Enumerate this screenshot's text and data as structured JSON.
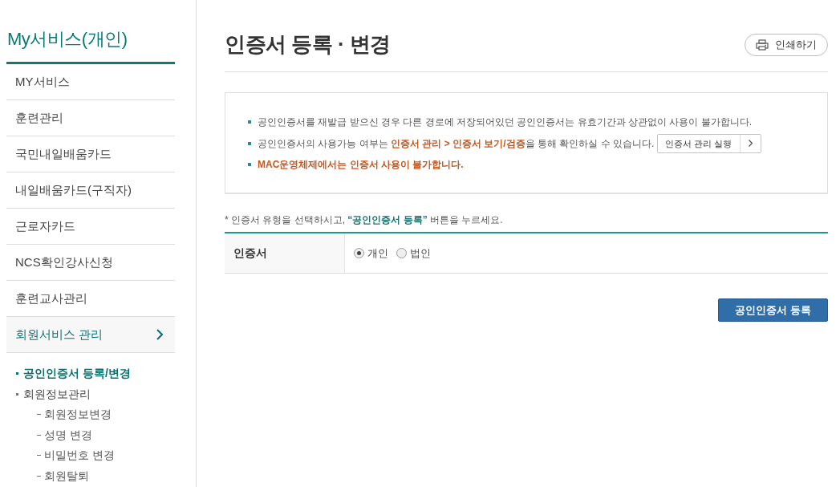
{
  "sidebar": {
    "title": "My서비스(개인)",
    "items": [
      {
        "label": "MY서비스",
        "selected": false
      },
      {
        "label": "훈련관리",
        "selected": false
      },
      {
        "label": "국민내일배움카드",
        "selected": false
      },
      {
        "label": "내일배움카드(구직자)",
        "selected": false
      },
      {
        "label": "근로자카드",
        "selected": false
      },
      {
        "label": "NCS확인강사신청",
        "selected": false
      },
      {
        "label": "훈련교사관리",
        "selected": false
      },
      {
        "label": "회원서비스 관리",
        "selected": true,
        "children": [
          {
            "label": "공인인증서 등록/변경",
            "selected": true
          },
          {
            "label": "회원정보관리",
            "selected": false,
            "children": [
              {
                "label": "회원정보변경",
                "selected": false
              },
              {
                "label": "성명 변경",
                "selected": false
              },
              {
                "label": "비밀번호 변경",
                "selected": false
              },
              {
                "label": "회원탈퇴",
                "selected": false
              }
            ]
          }
        ]
      }
    ]
  },
  "page": {
    "title": "인증서 등록 · 변경",
    "print_button": "인쇄하기"
  },
  "notice": {
    "items": [
      {
        "text": "공인인증서를 재발급 받으신 경우 다른 경로에 저장되어있던 공인인증서는 유효기간과 상관없이 사용이 불가합니다."
      },
      {
        "text": "공인인증서의 사용가능 여부는 **인증서 관리 > 인증서 보기/검증**을 통해 확인하실 수 있습니다.",
        "button": "인증서 관리 실행"
      },
      {
        "text": "**MAC운영체제에서는 인증서 사용이 불가합니다.**"
      }
    ]
  },
  "instruction": "* 인증서 유형을 선택하시고, **“공인인증서 등록”** 버튼을 누르세요.",
  "form": {
    "rows": [
      {
        "label": "인증서",
        "options": [
          {
            "label": "개인",
            "selected": true
          },
          {
            "label": "법인",
            "selected": false
          }
        ]
      }
    ]
  },
  "submit_button": "공인인증서 등록"
}
